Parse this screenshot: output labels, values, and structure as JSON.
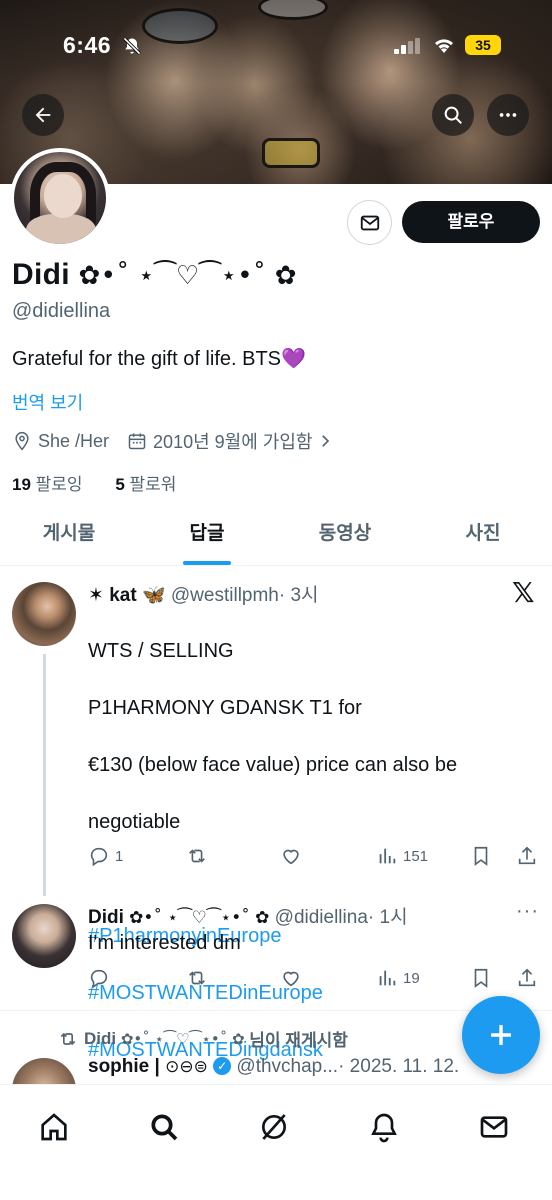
{
  "status_bar": {
    "time": "6:46",
    "battery": "35"
  },
  "profile": {
    "display_name": "Didi",
    "display_name_deco": "✿•˚ ⋆⁀♡⁀⋆•˚ ✿",
    "handle": "@didiellina",
    "bio": "Grateful for the gift of life. BTS💜",
    "translate_label": "번역 보기",
    "pronouns": "She /Her",
    "joined": "2010년 9월에 가입함",
    "following_count": "19",
    "following_label": "팔로잉",
    "followers_count": "5",
    "followers_label": "팔로워",
    "follow_button": "팔로우"
  },
  "tabs": [
    {
      "label": "게시물"
    },
    {
      "label": "답글",
      "active": true
    },
    {
      "label": "동영상"
    },
    {
      "label": "사진"
    }
  ],
  "posts": [
    {
      "name": "✶ kat 🦋",
      "handle": "@westillpmh",
      "time": "· 3시",
      "lines": [
        "WTS / SELLING",
        "P1HARMONY GDANSK T1 for",
        "€130 (below face value) price can also be",
        "negotiable"
      ],
      "hashtags": [
        "#P1harmonyinEurope",
        "#MOSTWANTEDinEurope",
        "#MOSTWANTEDingdansk"
      ],
      "replies": "1",
      "views": "151"
    },
    {
      "name": "Didi",
      "name_deco": "✿•˚ ⋆⁀♡⁀⋆•˚ ✿",
      "handle": "@didiellina",
      "time": "· 1시",
      "text": "I'm interested dm",
      "views": "19"
    }
  ],
  "repost": {
    "name": "Didi",
    "name_deco": "✿•˚ ⋆⁀♡⁀⋆•˚ ✿",
    "suffix": "님이 재게시함",
    "author": "sophie |",
    "author_deco": "⊙⊖⊜",
    "handle": "@thvchap...",
    "time": "· 2025. 11. 12."
  },
  "colors": {
    "accent": "#1d9bf0",
    "text": "#0f1419",
    "muted": "#536471"
  }
}
